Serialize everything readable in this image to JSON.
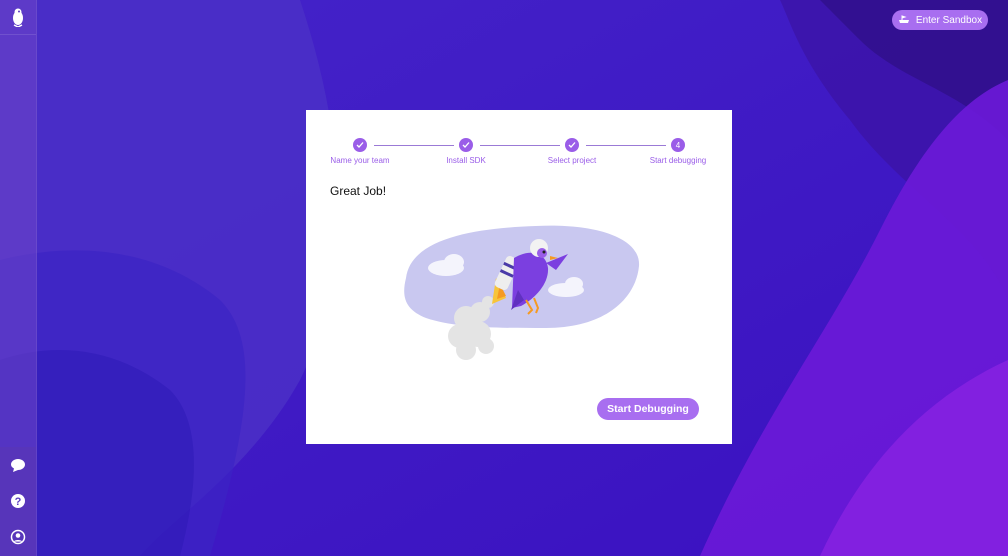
{
  "header": {
    "sandbox_label": "Enter Sandbox"
  },
  "sidebar": {
    "logo": "bird-logo-icon",
    "bottom_items": [
      {
        "icon": "chat-icon"
      },
      {
        "icon": "help-icon"
      },
      {
        "icon": "user-icon"
      }
    ]
  },
  "stepper": {
    "steps": [
      {
        "label": "Name your team",
        "state": "done",
        "marker": ""
      },
      {
        "label": "Install SDK",
        "state": "done",
        "marker": ""
      },
      {
        "label": "Select project",
        "state": "done",
        "marker": ""
      },
      {
        "label": "Start debugging",
        "state": "current",
        "marker": "4"
      }
    ]
  },
  "main": {
    "heading": "Great Job!",
    "cta_label": "Start Debugging"
  },
  "colors": {
    "accent": "#a86ef0",
    "step": "#9a5de8",
    "background": "#3b17c9"
  }
}
